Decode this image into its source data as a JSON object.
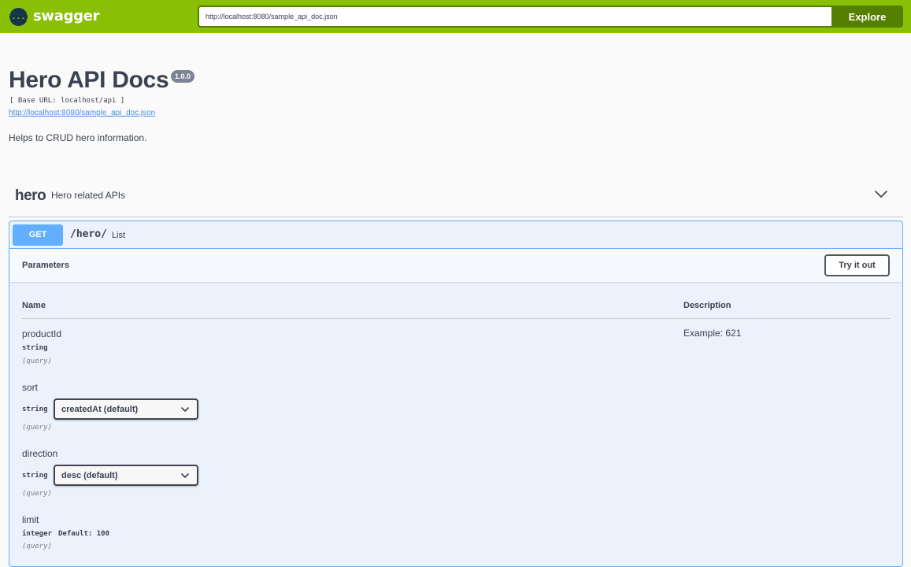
{
  "topbar": {
    "logo_mark": "{...}",
    "logo_text": "swagger",
    "url_value": "http://localhost:8080/sample_api_doc.json",
    "explore_label": "Explore"
  },
  "info": {
    "title": "Hero API Docs",
    "version": "1.0.0",
    "base_url": "[ Base URL: localhost/api ]",
    "spec_link": "http://localhost:8080/sample_api_doc.json",
    "description": "Helps to CRUD hero information."
  },
  "tag": {
    "name": "hero",
    "description": "Hero related APIs",
    "chevron_icon": "chevron-down-icon"
  },
  "operation": {
    "method": "GET",
    "path": "/hero/",
    "summary": "List",
    "method_color": "#61affe",
    "params_title": "Parameters",
    "try_label": "Try it out",
    "col_name": "Name",
    "col_description": "Description",
    "params": [
      {
        "name": "productId",
        "type": "string",
        "in": "(query)",
        "description": "Example: 621"
      },
      {
        "name": "sort",
        "type": "string",
        "in": "(query)",
        "selected": "createdAt (default)"
      },
      {
        "name": "direction",
        "type": "string",
        "in": "(query)",
        "selected": "desc (default)"
      },
      {
        "name": "limit",
        "type": "integer",
        "default": "Default: 100",
        "in": "(query)"
      }
    ]
  },
  "colors": {
    "topbar": "#89bf04",
    "topbar_dark": "#547f00",
    "text": "#3b4151",
    "link": "#4990e2",
    "get": "#61affe",
    "get_bg": "#ebf2fb"
  }
}
